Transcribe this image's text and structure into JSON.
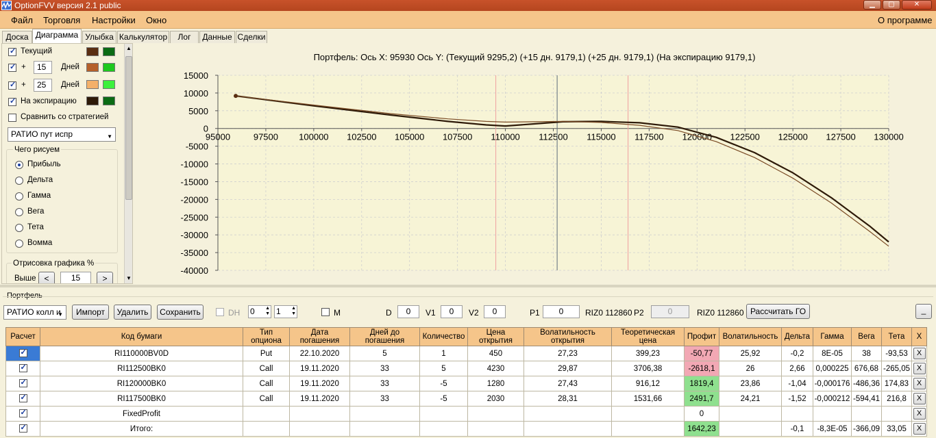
{
  "window": {
    "title": "OptionFVV версия 2.1 public"
  },
  "menu": {
    "items": [
      "Файл",
      "Торговля",
      "Настройки",
      "Окно"
    ],
    "about": "О программе"
  },
  "tabs": [
    "Доска",
    "Диаграмма",
    "Улыбка",
    "Калькулятор",
    "Лог",
    "Данные",
    "Сделки"
  ],
  "left_panel": {
    "current_label": "Текущий",
    "plus": "+",
    "days_label": "Дней",
    "offset1": "15",
    "offset2": "25",
    "expiration_label": "На экспирацию",
    "compare_label": "Сравнить со стратегией",
    "strategy": "РАТИО пут испр",
    "draw_group": "Чего рисуем",
    "draw_options": [
      "Прибыль",
      "Дельта",
      "Гамма",
      "Вега",
      "Тета",
      "Вомма"
    ],
    "render_group": "Отрисовка графика %",
    "higher_label": "Выше",
    "render_value": "15",
    "colors": {
      "current": [
        "#5a2e12",
        "#0b6b14"
      ],
      "d15": [
        "#b5602a",
        "#1ec81e"
      ],
      "d25": [
        "#f4b06a",
        "#3cf03c"
      ],
      "exp": [
        "#2e1a08",
        "#0b6b14"
      ]
    }
  },
  "chart_header": "Портфель:  Ось X:  95930  Ось Y:   (Текущий 9295,2)   (+15 дн. 9179,1)   (+25 дн. 9179,1)   (На экспирацию 9179,1)",
  "chart_data": {
    "type": "line",
    "xticks": [
      "95000",
      "97500",
      "100000",
      "102500",
      "105000",
      "107500",
      "110000",
      "112500",
      "115000",
      "117500",
      "120000",
      "122500",
      "125000",
      "127500",
      "130000"
    ],
    "yticks": [
      "15000",
      "10000",
      "5000",
      "0",
      "-5000",
      "-10000",
      "-15000",
      "-20000",
      "-25000",
      "-30000",
      "-35000",
      "-40000"
    ],
    "xlim": [
      95000,
      130000
    ],
    "ylim": [
      -40000,
      15000
    ],
    "cursor_x": 112700,
    "markers_x": [
      109500,
      116400
    ],
    "marker_point": [
      95930,
      9179
    ],
    "series": [
      {
        "color": "#2e1a08",
        "width": 2.2,
        "x": [
          95930,
          100000,
          104000,
          107000,
          109000,
          110000,
          111500,
          113000,
          115000,
          117000,
          119000,
          121000,
          123000,
          125000,
          127000,
          129000,
          130000
        ],
        "y": [
          9200,
          6400,
          3800,
          2000,
          1000,
          700,
          1300,
          1900,
          2000,
          1600,
          400,
          -2500,
          -6800,
          -12500,
          -19500,
          -27500,
          -32000
        ]
      },
      {
        "color": "#7a4a24",
        "width": 1.2,
        "x": [
          95930,
          100000,
          104000,
          107000,
          109000,
          110000,
          111500,
          113000,
          115000,
          117000,
          119000,
          121000,
          123000,
          125000,
          127000,
          129000,
          130000
        ],
        "y": [
          9200,
          6600,
          4200,
          2700,
          2000,
          1800,
          1900,
          2000,
          1700,
          900,
          -600,
          -3700,
          -8200,
          -14000,
          -21000,
          -29000,
          -33200
        ]
      }
    ]
  },
  "portfolio": {
    "group_label": "Портфель",
    "selected": "РАТИО колл и",
    "import": "Импорт",
    "delete": "Удалить",
    "save": "Сохранить",
    "dh": "DH",
    "spin1": "0",
    "spin2": "1",
    "m": "M",
    "d_label": "D",
    "d_value": "0",
    "v1_label": "V1",
    "v1_value": "0",
    "v2_label": "V2",
    "v2_value": "0",
    "p1_label": "P1",
    "p1_value": "0",
    "p1_code": "RIZ0 112860",
    "p2_label": "P2",
    "p2_value": "0",
    "p2_code": "RIZ0 112860",
    "calc_go": "Рассчитать ГО",
    "minimize": "_"
  },
  "table": {
    "headers": [
      "Расчет",
      "Код бумаги",
      "Тип опциона",
      "Дата погашения",
      "Дней до погашения",
      "Количество",
      "Цена открытия",
      "Волатильность открытия",
      "Теоретическая цена",
      "Профит",
      "Волатильность",
      "Дельта",
      "Гамма",
      "Вега",
      "Тета",
      "X"
    ],
    "rows": [
      [
        "RI110000BV0D",
        "Put",
        "22.10.2020",
        "5",
        "1",
        "450",
        "27,23",
        "399,23",
        "-50,77",
        "25,92",
        "-0,2",
        "8E-05",
        "38",
        "-93,53"
      ],
      [
        "RI112500BK0",
        "Call",
        "19.11.2020",
        "33",
        "5",
        "4230",
        "29,87",
        "3706,38",
        "-2618,1",
        "26",
        "2,66",
        "0,000225",
        "676,68",
        "-265,05"
      ],
      [
        "RI120000BK0",
        "Call",
        "19.11.2020",
        "33",
        "-5",
        "1280",
        "27,43",
        "916,12",
        "1819,4",
        "23,86",
        "-1,04",
        "-0,000176",
        "-486,36",
        "174,83"
      ],
      [
        "RI117500BK0",
        "Call",
        "19.11.2020",
        "33",
        "-5",
        "2030",
        "28,31",
        "1531,66",
        "2491,7",
        "24,21",
        "-1,52",
        "-0,000212",
        "-594,41",
        "216,8"
      ],
      [
        "FixedProfit",
        "",
        "",
        "",
        "",
        "",
        "",
        "",
        "0",
        "",
        "",
        "",
        "",
        ""
      ],
      [
        "Итого:",
        "",
        "",
        "",
        "",
        "",
        "",
        "",
        "1642,23",
        "",
        "-0,1",
        "-8,3E-05",
        "-366,09",
        "33,05"
      ]
    ],
    "profit_status": [
      "neg",
      "neg",
      "pos",
      "pos",
      "none",
      "pos"
    ],
    "delete_symbol": "X"
  }
}
